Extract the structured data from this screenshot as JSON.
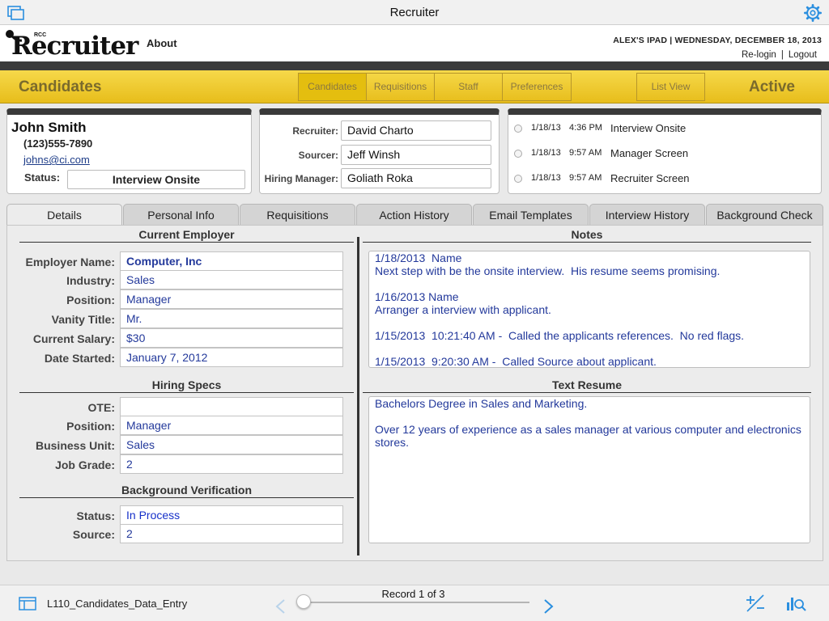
{
  "app": {
    "title": "Recruiter",
    "logo_text": "Recruiter",
    "logo_small": "RCC"
  },
  "header": {
    "about_label": "About",
    "device": "ALEX'S IPAD  |  WEDNESDAY, DECEMBER 18, 2013",
    "relogin_label": "Re-login",
    "sep": "|",
    "logout_label": "Logout"
  },
  "nav": {
    "section_title": "Candidates",
    "status": "Active",
    "tabs": [
      "Candidates",
      "Requisitions",
      "Staff",
      "Preferences"
    ],
    "selected_tab": "Candidates",
    "listview_label": "List View"
  },
  "candidate": {
    "name": "John Smith",
    "phone": "(123)555-7890",
    "email": "johns@ci.com",
    "status_label": "Status:",
    "status": "Interview Onsite"
  },
  "contacts": [
    {
      "label": "Recruiter:",
      "value": "David Charto"
    },
    {
      "label": "Sourcer:",
      "value": "Jeff Winsh"
    },
    {
      "label": "Hiring Manager:",
      "value": "Goliath Roka"
    }
  ],
  "history": [
    {
      "date": "1/18/13",
      "time": "4:36 PM",
      "event": "Interview Onsite"
    },
    {
      "date": "1/18/13",
      "time": "9:57 AM",
      "event": "Manager Screen"
    },
    {
      "date": "1/18/13",
      "time": "9:57 AM",
      "event": "Recruiter Screen"
    }
  ],
  "tabs": [
    "Details",
    "Personal Info",
    "Requisitions",
    "Action History",
    "Email Templates",
    "Interview History",
    "Background Check"
  ],
  "active_tab": "Details",
  "details": {
    "current_employer": {
      "title": "Current Employer",
      "fields": [
        {
          "label": "Employer Name:",
          "value": "Computer, Inc"
        },
        {
          "label": "Industry:",
          "value": "Sales"
        },
        {
          "label": "Position:",
          "value": "Manager"
        },
        {
          "label": "Vanity Title:",
          "value": "Mr."
        },
        {
          "label": "Current Salary:",
          "value": "$30"
        },
        {
          "label": "Date Started:",
          "value": "January 7, 2012"
        }
      ]
    },
    "hiring_specs": {
      "title": "Hiring Specs",
      "fields": [
        {
          "label": "OTE:",
          "value": ""
        },
        {
          "label": "Position:",
          "value": "Manager"
        },
        {
          "label": "Business Unit:",
          "value": "Sales"
        },
        {
          "label": "Job Grade:",
          "value": "2"
        }
      ]
    },
    "background": {
      "title": "Background Verification",
      "fields": [
        {
          "label": "Status:",
          "value": "In Process"
        },
        {
          "label": "Source:",
          "value": "2"
        }
      ]
    },
    "notes": {
      "title": "Notes",
      "text": "1/18/2013  Name\nNext step with be the onsite interview.  His resume seems promising.\n\n1/16/2013 Name\nArranger a interview with applicant.\n\n1/15/2013  10:21:40 AM -  Called the applicants references.  No red flags.\n\n1/15/2013  9:20:30 AM -  Called Source about applicant."
    },
    "resume": {
      "title": "Text Resume",
      "text": "Bachelors Degree in Sales and Marketing.\n\nOver 12 years of experience as a sales manager at various computer and electronics stores."
    }
  },
  "footer": {
    "layout_name": "L110_Candidates_Data_Entry",
    "record_text": "Record 1 of 3",
    "record_current": 1,
    "record_total": 3
  },
  "colors": {
    "accent_yellow": "#e7bd1b",
    "dark_bar": "#3b3b3b",
    "value_blue": "#23399b",
    "ios_blue": "#2b8fdf"
  }
}
